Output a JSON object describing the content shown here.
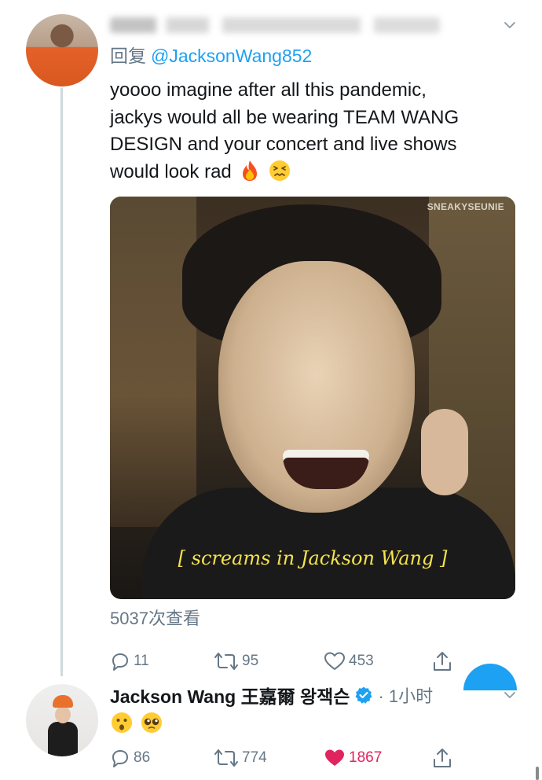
{
  "tweet": {
    "reply_prefix": "回复",
    "reply_to": "@JacksonWang852",
    "text_lines": [
      "yoooo imagine after all this pandemic,",
      "jackys would all be wearing TEAM WANG",
      "DESIGN and your concert and live shows",
      "would look rad"
    ],
    "emojis": [
      "fire-emoji",
      "confounded-face-emoji"
    ],
    "media": {
      "watermark": "SNEAKYSEUNIE",
      "caption": "[ screams in Jackson Wang ]"
    },
    "view_count": "5037次查看",
    "actions": {
      "replies": "11",
      "retweets": "95",
      "likes": "453"
    }
  },
  "reply": {
    "display_name": "Jackson Wang 王嘉爾 왕잭슨",
    "time": "· 1小时",
    "emojis": [
      "hushed-face-emoji",
      "pleading-face-emoji"
    ],
    "actions": {
      "replies": "86",
      "retweets": "774",
      "likes": "1867"
    }
  },
  "colors": {
    "link_blue": "#1da1f2",
    "muted_gray": "#657786",
    "like_red": "#e0245e",
    "caption_yellow": "#f3e34d"
  }
}
